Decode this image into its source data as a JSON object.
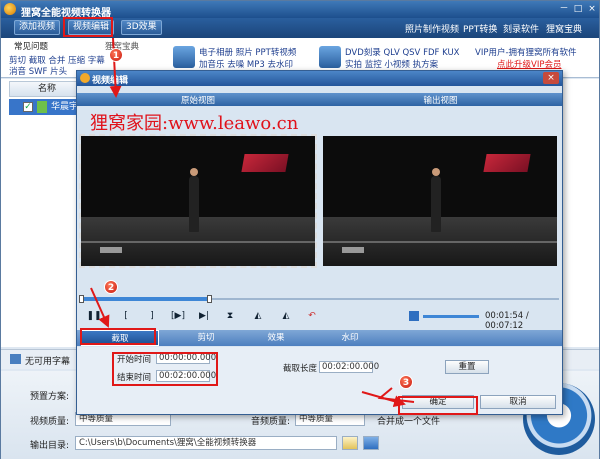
{
  "app": {
    "title": "狸窝全能视频转换器",
    "controls": [
      "－",
      "□",
      "×"
    ]
  },
  "toolbar": {
    "add_video": "添加视频",
    "video_edit": "视频编辑",
    "effects_3d": "3D效果",
    "links": [
      "照片制作视频",
      "PPT转换",
      "刻录软件",
      "狸窝宝典"
    ]
  },
  "promo": {
    "faq": "常见问题",
    "treasure": "狸窝宝典",
    "line1": "剪切 截取 合并 压缩 字幕",
    "line2": "消音 SWF 片头",
    "ad1_line1": "电子相册 照片 PPT转视频",
    "ad1_line2": "加音乐 去噪 MP3 去水印",
    "ad2_line1": "DVD刻录 QLV QSV FDF KUX",
    "ad2_line2": "实拍 监控 小视频 执方案",
    "vip_line1": "VIP用户-拥有狸窝所有软件",
    "vip_line2": "点此升级VIP会员"
  },
  "file_list": {
    "header_name": "名称",
    "row_name": "华晨宇"
  },
  "subtitle_bar": {
    "label": "无可用字幕"
  },
  "bottom": {
    "preset_label": "预置方案:",
    "quality_label": "视频质量:",
    "quality_value": "中等质量",
    "audio_quality_label": "音频质量:",
    "audio_quality_value": "中等质量",
    "merge_label": "合并成一个文件",
    "output_label": "输出目录:",
    "output_path": "C:\\Users\\b\\Documents\\狸窝\\全能视频转换器"
  },
  "dialog": {
    "title": "视频编辑",
    "close": "×",
    "original_view": "原始视图",
    "output_view": "输出视图",
    "watermark": "狸窝家园:www.leawo.cn",
    "time_display": "00:01:54 / 00:07:12",
    "progress": 0.27,
    "tabs": [
      "截取",
      "剪切",
      "效果",
      "水印"
    ],
    "start_time_label": "开始时间",
    "start_time": "00:00:00.000",
    "end_time_label": "结束时间",
    "end_time": "00:02:00.000",
    "clip_length_label": "截取长度",
    "clip_length": "00:02:00.000",
    "reset_button": "重置",
    "ok_button": "确定",
    "cancel_button": "取消",
    "control_glyphs": [
      "❚❚",
      "[",
      "]",
      "[▶]",
      "▶|",
      "⧗",
      "◭",
      "◭",
      "↶"
    ]
  },
  "callouts": [
    "1",
    "2",
    "3"
  ],
  "colors": {
    "accent": "#2a5f9e",
    "highlight": "#e01818",
    "progress": "#3e86d6"
  }
}
